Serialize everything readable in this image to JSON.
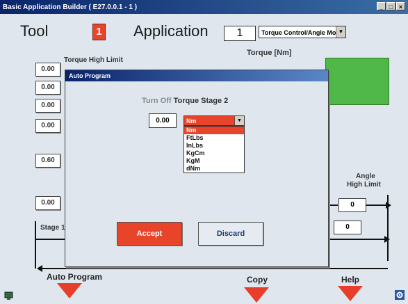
{
  "window": {
    "title": "Basic Application Builder  ( E27.0.0.1 - 1 )",
    "controls": [
      "_",
      "□",
      "×"
    ]
  },
  "header": {
    "tool_label": "Tool",
    "tool_number": "1",
    "application_label": "Application",
    "application_number": "1",
    "application_type": "Torque Control/Angle Monit"
  },
  "left_rows": {
    "values": [
      "0.00",
      "0.00",
      "0.00",
      "0.00",
      "0.60",
      "0.00"
    ],
    "first_label": "Torque High Limit"
  },
  "graph": {
    "torque_label": "Torque [Nm]",
    "angle_high_label_1": "Angle",
    "angle_high_label_2": "High Limit",
    "angle_high_value": "0",
    "angle_value": "0",
    "stage_label": "Stage 1"
  },
  "bottom": {
    "auto_program": "Auto Program",
    "copy": "Copy",
    "help": "Help"
  },
  "dialog": {
    "title": "Auto Program",
    "heading_light": "Turn Off",
    "heading_bold": "Torque Stage 2",
    "value": "0.00",
    "selected_unit": "Nm",
    "unit_options": [
      "Nm",
      "FtLbs",
      "InLbs",
      "KgCm",
      "KgM",
      "dNm"
    ],
    "accept_label": "Accept",
    "discard_label": "Discard"
  },
  "colors": {
    "accent_red": "#e8442a",
    "graph_green": "#4fb848",
    "titlebar_blue": "#0a246a"
  }
}
